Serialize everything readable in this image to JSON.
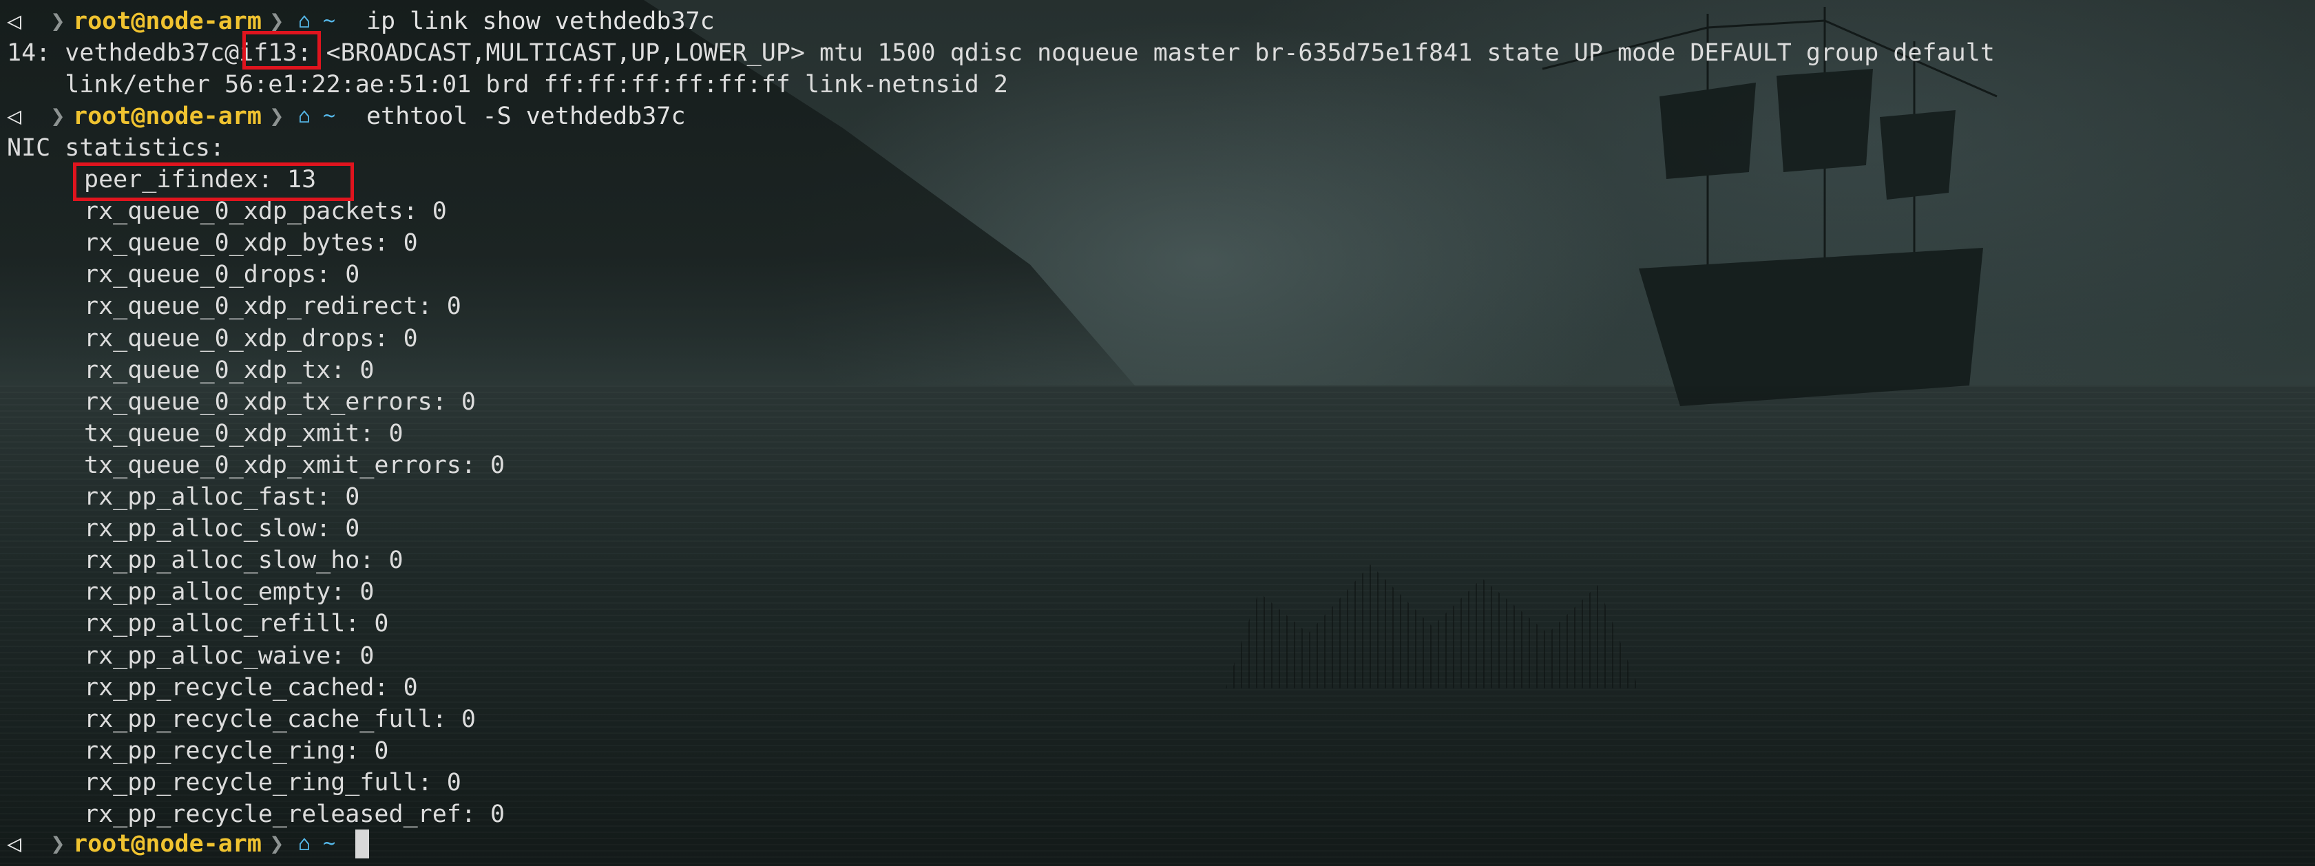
{
  "colors": {
    "prompt_user": "#f0c330",
    "prompt_home_icon": "#55b7e8",
    "text": "#dcdcdc",
    "highlight_box": "#e0141e"
  },
  "prompt": {
    "os_icon": "linux-icon",
    "separator": "❯",
    "user_host": "root@node-arm",
    "home_icon": "home-icon",
    "home_path": "~"
  },
  "commands": {
    "first": "ip link show vethdedb37c",
    "second": "ethtool -S vethdedb37c"
  },
  "ip_output": {
    "line1_prefix": "14: vethdedb37c@",
    "line1_peer": "if13",
    "line1_suffix": ": <BROADCAST,MULTICAST,UP,LOWER_UP> mtu 1500 qdisc noqueue master br-635d75e1f841 state UP mode DEFAULT group default",
    "line2": "    link/ether 56:e1:22:ae:51:01 brd ff:ff:ff:ff:ff:ff link-netnsid 2"
  },
  "ethtool_output": {
    "header": "NIC statistics:",
    "stats": [
      "peer_ifindex: 13",
      "rx_queue_0_xdp_packets: 0",
      "rx_queue_0_xdp_bytes: 0",
      "rx_queue_0_drops: 0",
      "rx_queue_0_xdp_redirect: 0",
      "rx_queue_0_xdp_drops: 0",
      "rx_queue_0_xdp_tx: 0",
      "rx_queue_0_xdp_tx_errors: 0",
      "tx_queue_0_xdp_xmit: 0",
      "tx_queue_0_xdp_xmit_errors: 0",
      "rx_pp_alloc_fast: 0",
      "rx_pp_alloc_slow: 0",
      "rx_pp_alloc_slow_ho: 0",
      "rx_pp_alloc_empty: 0",
      "rx_pp_alloc_refill: 0",
      "rx_pp_alloc_waive: 0",
      "rx_pp_recycle_cached: 0",
      "rx_pp_recycle_cache_full: 0",
      "rx_pp_recycle_ring: 0",
      "rx_pp_recycle_ring_full: 0",
      "rx_pp_recycle_released_ref: 0"
    ]
  }
}
